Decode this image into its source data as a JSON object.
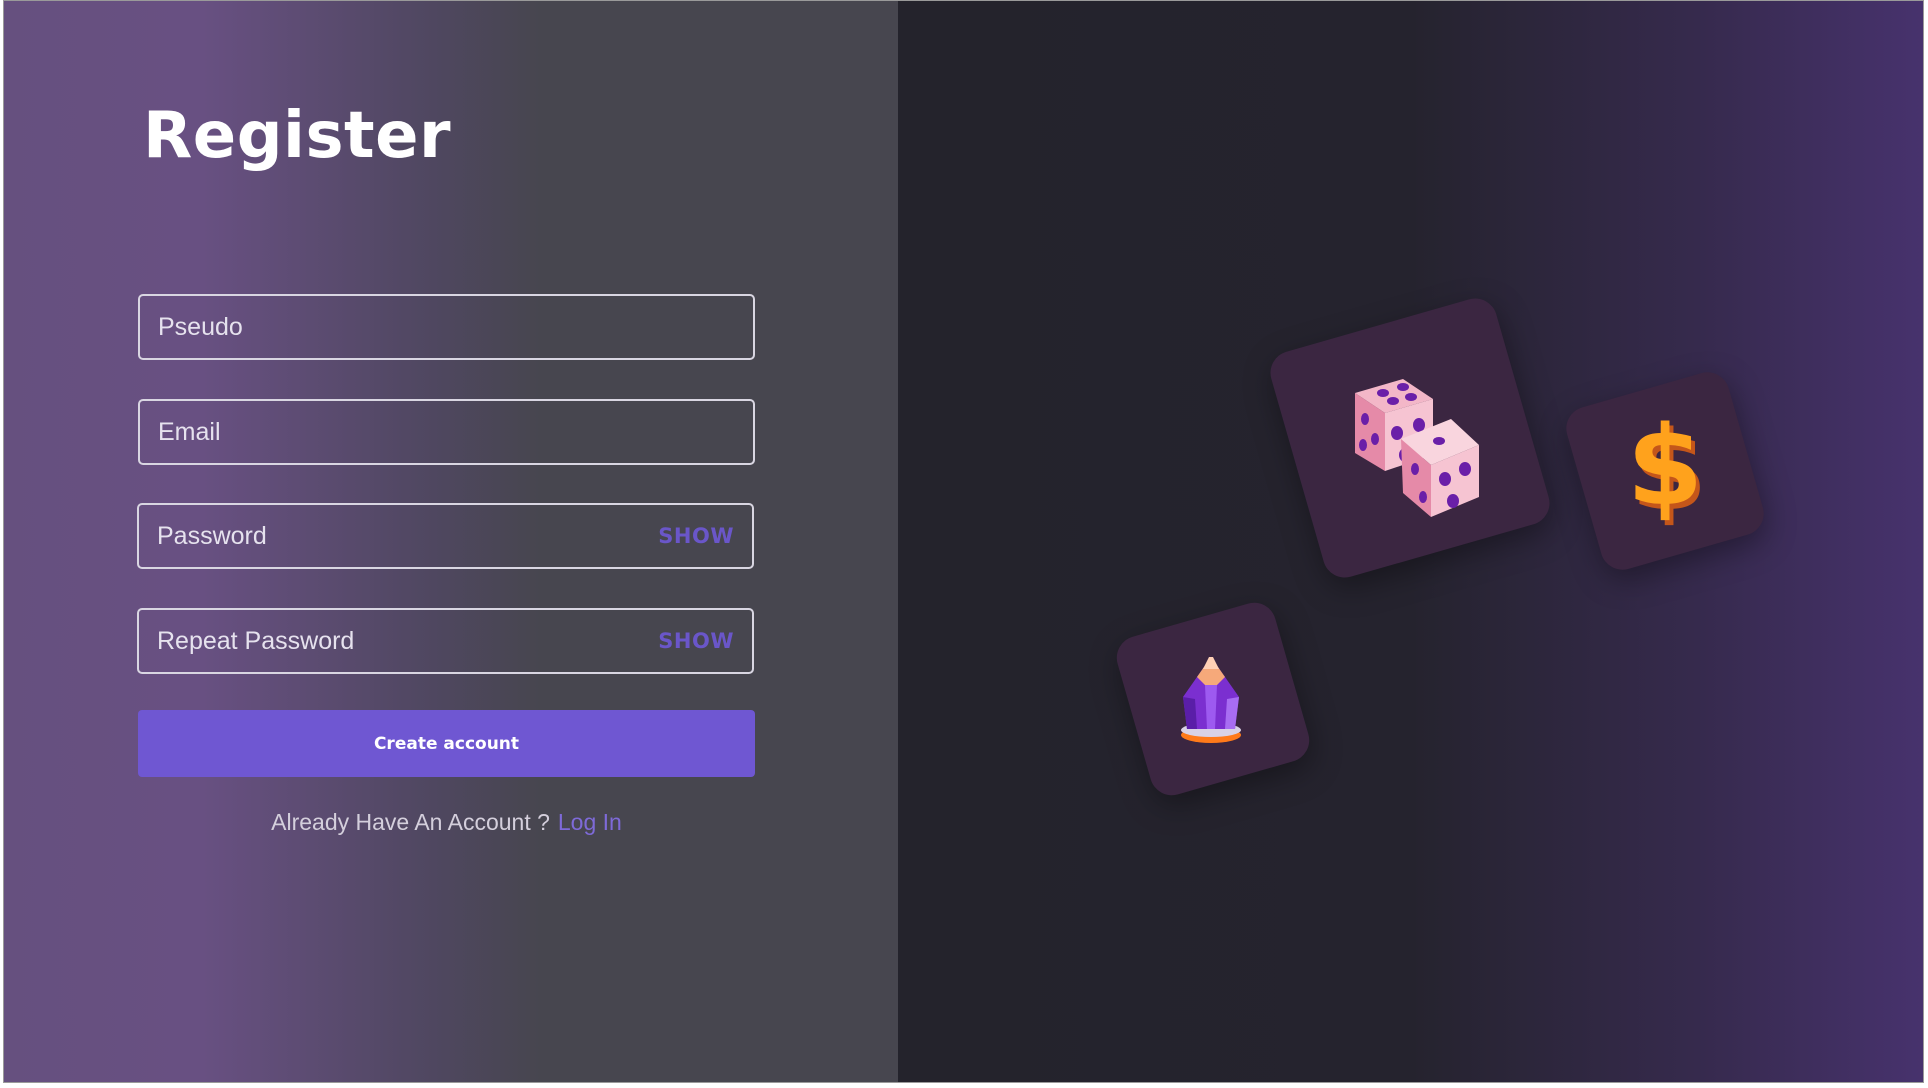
{
  "register": {
    "title": "Register",
    "fields": {
      "pseudo": {
        "placeholder": "Pseudo"
      },
      "email": {
        "placeholder": "Email"
      },
      "password": {
        "placeholder": "Password",
        "toggle_label": "SHOW"
      },
      "repeat_password": {
        "placeholder": "Repeat Password",
        "toggle_label": "SHOW"
      }
    },
    "submit_label": "Create account",
    "login_prompt": "Already Have An Account ?",
    "login_link": "Log In"
  },
  "illustrations": {
    "cards": [
      {
        "icon": "dice-icon"
      },
      {
        "icon": "dollar-sign-icon"
      },
      {
        "icon": "crystal-gem-icon"
      }
    ]
  },
  "colors": {
    "accent": "#6f57d2",
    "link": "#7e6ad8",
    "card_bg": "#3b2641"
  }
}
